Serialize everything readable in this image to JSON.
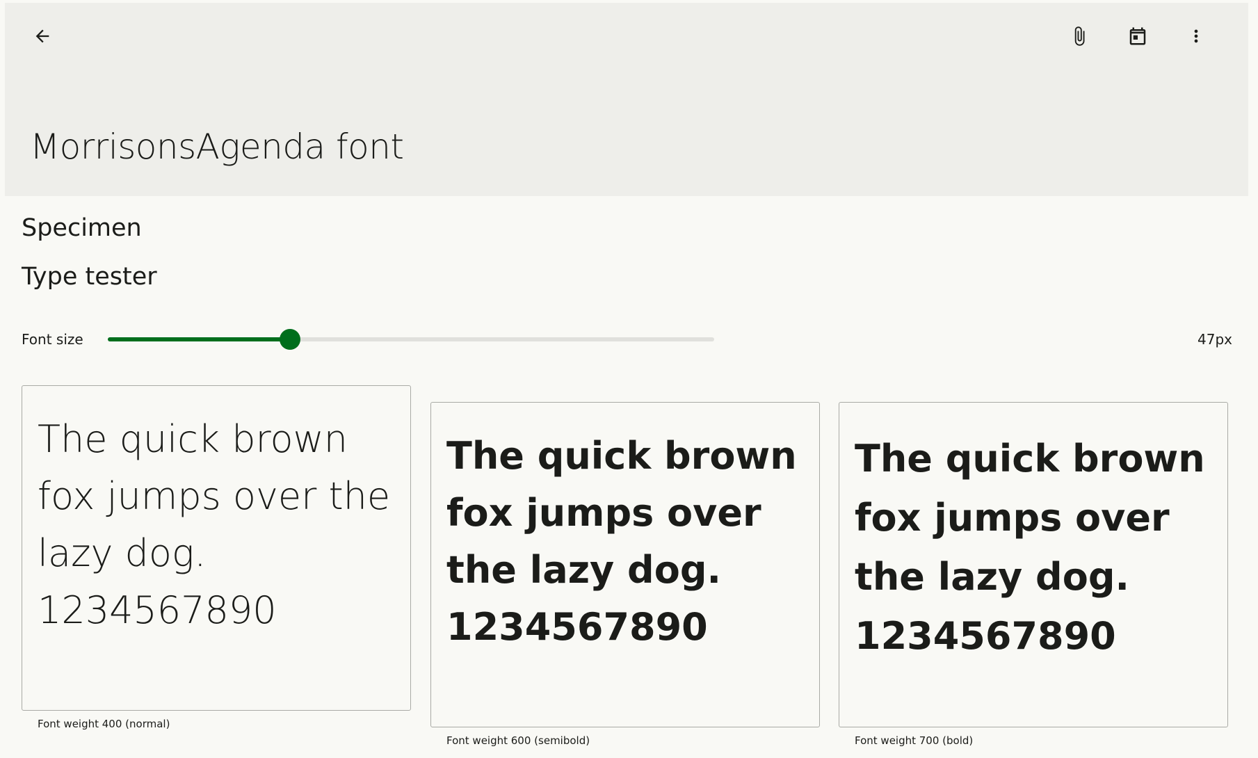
{
  "app_bar": {
    "title": "MorrisonsAgenda font",
    "icons": {
      "back": "arrow-back-icon",
      "attach": "attach-icon",
      "calendar": "calendar-icon",
      "more": "more-vert-icon"
    }
  },
  "nav": {
    "specimen_label": "Specimen",
    "type_tester_label": "Type tester"
  },
  "type_tester": {
    "font_size_label": "Font size",
    "font_size_value": "47px",
    "slider_fraction": 0.3,
    "accent_color": "#006e1c"
  },
  "specimens": [
    {
      "sample_text": "The quick brown fox jumps over the lazy dog. 1234567890",
      "caption": "Font weight 400 (normal)"
    },
    {
      "sample_text": "The quick brown fox jumps over the lazy dog. 1234567890",
      "caption": "Font weight 600 (semibold)"
    },
    {
      "sample_text": "The quick brown fox jumps over the lazy dog. 1234567890",
      "caption": "Font weight 700 (bold)"
    }
  ]
}
